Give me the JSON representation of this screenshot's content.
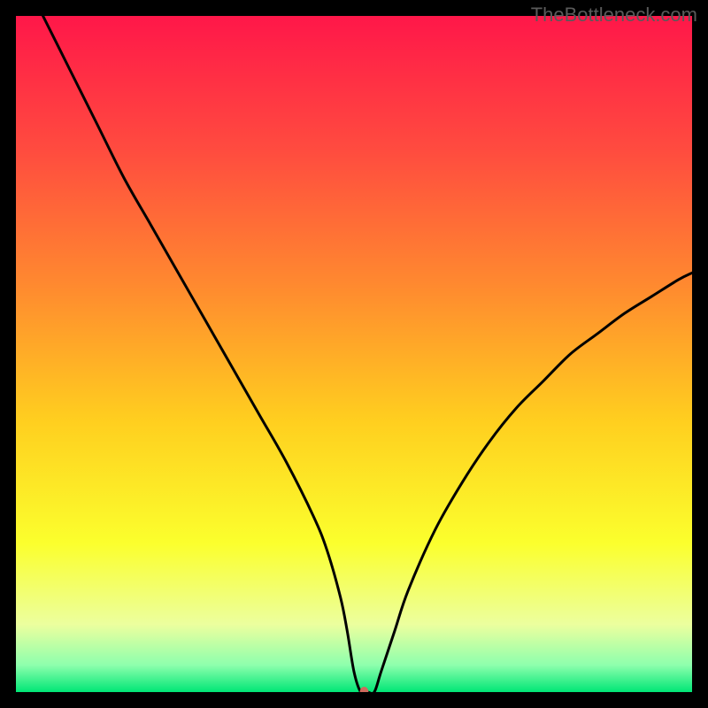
{
  "watermark": "TheBottleneck.com",
  "chart_data": {
    "type": "line",
    "title": "",
    "xlabel": "",
    "ylabel": "",
    "xlim": [
      0,
      100
    ],
    "ylim": [
      0,
      100
    ],
    "grid": false,
    "legend": false,
    "background_gradient": {
      "stops": [
        {
          "offset": 0.0,
          "color": "#ff1749"
        },
        {
          "offset": 0.2,
          "color": "#ff4c3f"
        },
        {
          "offset": 0.4,
          "color": "#ff8a2f"
        },
        {
          "offset": 0.6,
          "color": "#ffcf1f"
        },
        {
          "offset": 0.78,
          "color": "#fbff2d"
        },
        {
          "offset": 0.9,
          "color": "#ecff9e"
        },
        {
          "offset": 0.96,
          "color": "#8effad"
        },
        {
          "offset": 1.0,
          "color": "#00e676"
        }
      ]
    },
    "series": [
      {
        "name": "bottleneck-curve",
        "color": "#000000",
        "x": [
          4,
          8,
          12,
          16,
          20,
          24,
          28,
          32,
          36,
          40,
          44,
          46,
          48,
          49,
          50,
          51,
          52,
          53,
          54,
          56,
          58,
          62,
          66,
          70,
          74,
          78,
          82,
          86,
          90,
          94,
          98,
          100
        ],
        "y": [
          100,
          92,
          84,
          76,
          69,
          62,
          55,
          48,
          41,
          34,
          26,
          21,
          14,
          9,
          3,
          0,
          0,
          0,
          3,
          9,
          15,
          24,
          31,
          37,
          42,
          46,
          50,
          53,
          56,
          58.5,
          61,
          62
        ]
      }
    ],
    "marker": {
      "name": "sweet-spot",
      "x": 51.5,
      "y": 0,
      "color": "#cf6a5c",
      "rx": 5,
      "ry": 6
    }
  }
}
